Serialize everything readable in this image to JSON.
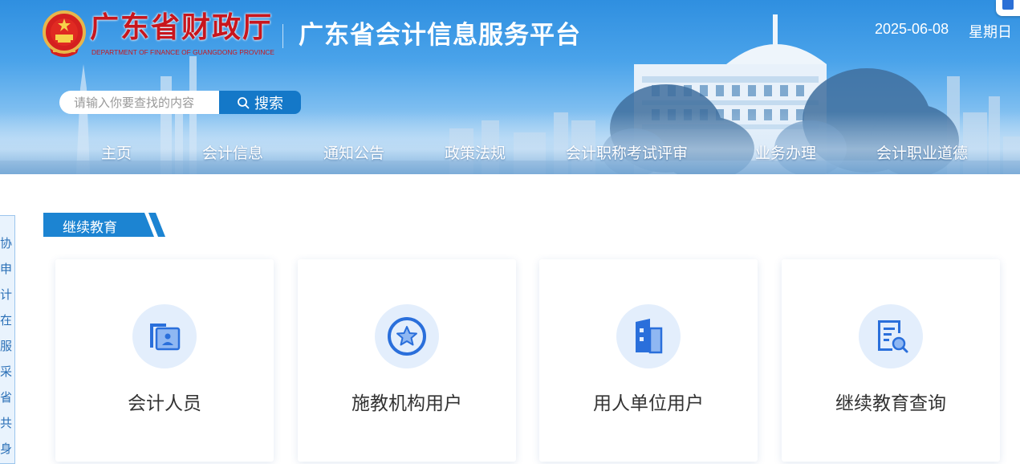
{
  "header": {
    "dept_name": "广东省财政厅",
    "dept_name_en": "DEPARTMENT OF FINANCE OF GUANGDONG PROVINCE",
    "platform_title": "广东省会计信息服务平台",
    "date": "2025-06-08",
    "weekday": "星期日",
    "emblem_icon": "national-emblem-icon"
  },
  "search": {
    "placeholder": "请输入你要查找的内容",
    "button_label": "搜索",
    "icon": "search-icon"
  },
  "nav": {
    "items": [
      "主页",
      "会计信息",
      "通知公告",
      "政策法规",
      "会计职称考试评审",
      "业务办理",
      "会计职业道德"
    ]
  },
  "side_tab": {
    "chars": [
      "协",
      "申",
      "计",
      "在",
      "服",
      "采",
      "省",
      "共",
      "身"
    ]
  },
  "section": {
    "title": "继续教育"
  },
  "cards": [
    {
      "label": "会计人员",
      "icon": "person-card-icon"
    },
    {
      "label": "施教机构用户",
      "icon": "star-badge-icon"
    },
    {
      "label": "用人单位用户",
      "icon": "building-icon"
    },
    {
      "label": "继续教育查询",
      "icon": "document-search-icon"
    }
  ],
  "colors": {
    "brand_red": "#c8161d",
    "primary_blue": "#1c84d2",
    "search_button": "#1478c8",
    "icon_blue": "#2a6fdb",
    "icon_bg": "#e3eefc"
  }
}
